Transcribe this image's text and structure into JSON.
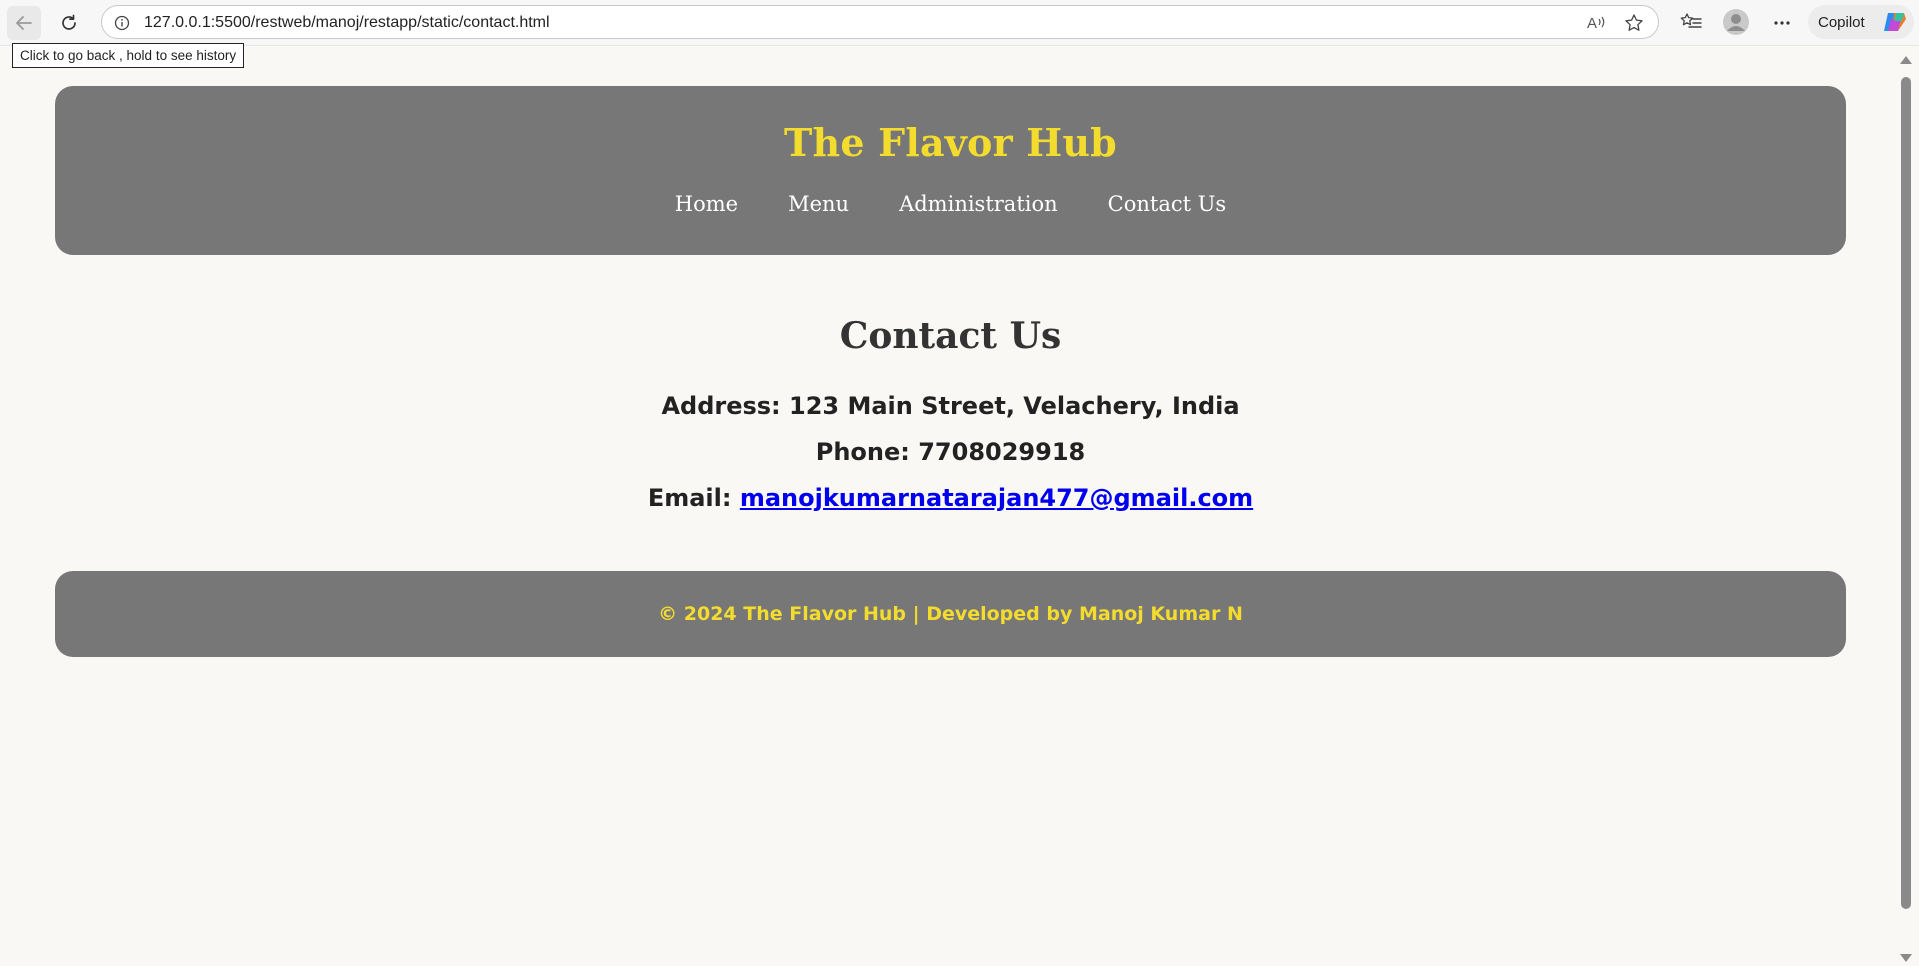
{
  "browser": {
    "url": "127.0.0.1:5500/restweb/manoj/restapp/static/contact.html",
    "copilot_label": "Copilot",
    "back_tooltip": "Click to go back , hold to see history",
    "icons": [
      "back-arrow-icon",
      "reload-icon",
      "info-icon",
      "read-aloud-icon",
      "favorite-star-icon",
      "favorites-list-icon",
      "profile-icon",
      "more-options-icon",
      "copilot-icon"
    ]
  },
  "header": {
    "title": "The Flavor Hub",
    "nav": [
      {
        "label": "Home"
      },
      {
        "label": "Menu"
      },
      {
        "label": "Administration"
      },
      {
        "label": "Contact Us"
      }
    ]
  },
  "contact": {
    "heading": "Contact Us",
    "address": "Address: 123 Main Street, Velachery, India",
    "phone": "Phone: 7708029918",
    "email_label": "Email: ",
    "email": "manojkumarnatarajan477@gmail.com"
  },
  "footer": {
    "text": "© 2024 The Flavor Hub | Developed by Manoj Kumar N"
  },
  "colors": {
    "page_background": "#f9f8f5",
    "panel_gray": "#777777",
    "title_yellow": "#f3dc2e",
    "link_blue": "#0000ee"
  }
}
